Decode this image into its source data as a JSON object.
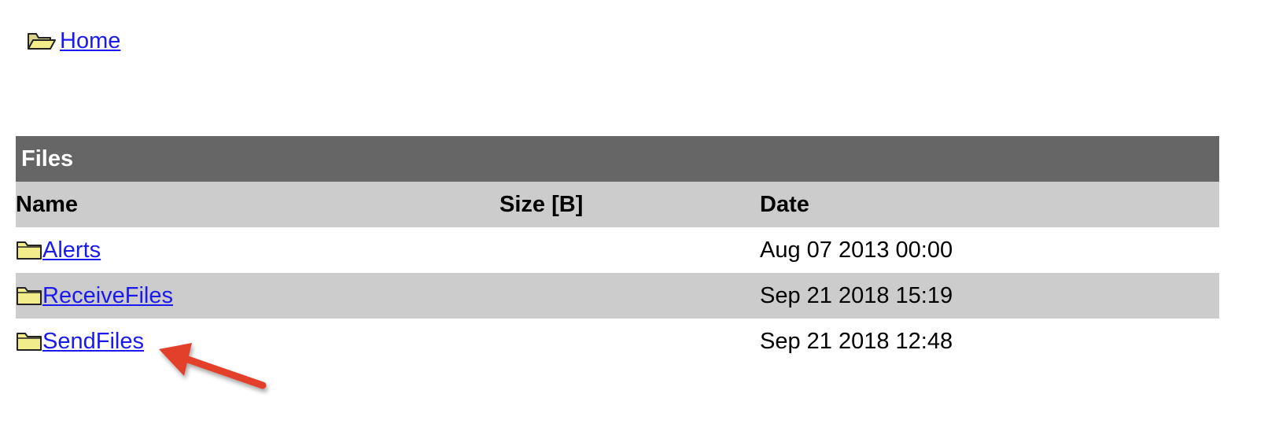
{
  "breadcrumb": {
    "icon": "open-folder-icon",
    "label": " Home"
  },
  "table": {
    "caption": "Files",
    "columns": [
      "Name",
      "Size [B]",
      "Date"
    ],
    "rows": [
      {
        "name": "Alerts",
        "size": "",
        "date": "Aug 07 2013 00:00",
        "icon": "folder-icon"
      },
      {
        "name": "ReceiveFiles",
        "size": "",
        "date": "Sep 21 2018 15:19",
        "icon": "folder-icon"
      },
      {
        "name": "SendFiles",
        "size": "",
        "date": "Sep 21 2018 12:48",
        "icon": "folder-icon"
      }
    ]
  },
  "annotation": {
    "icon": "red-arrow-icon",
    "color": "#e2402b"
  },
  "colors": {
    "caption_bg": "#666666",
    "header_bg": "#cccccc",
    "link": "#1a1aee",
    "folder_fill": "#f3ec8a"
  }
}
